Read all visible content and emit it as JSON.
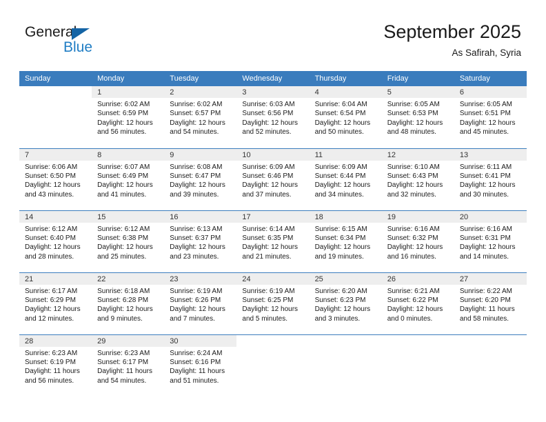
{
  "brand": {
    "name_top": "General",
    "name_bottom": "Blue",
    "triangle_icon": "blue-triangle-logo-mark",
    "colors": {
      "general_text": "#1a1a1a",
      "blue_text": "#1f7dc4",
      "triangle": "#1464a5"
    }
  },
  "header": {
    "title": "September 2025",
    "location": "As Safirah, Syria"
  },
  "theme": {
    "header_row_bg": "#3a7cbd",
    "header_row_text": "#ffffff",
    "daynum_band_bg": "#eeeeee",
    "cell_text": "#1a1a1a",
    "row_divider": "#3a7cbd"
  },
  "calendar": {
    "weekday_headers": [
      "Sunday",
      "Monday",
      "Tuesday",
      "Wednesday",
      "Thursday",
      "Friday",
      "Saturday"
    ],
    "weeks": [
      [
        {
          "blank": true
        },
        {
          "day": "1",
          "sunrise": "Sunrise: 6:02 AM",
          "sunset": "Sunset: 6:59 PM",
          "daylight": "Daylight: 12 hours and 56 minutes."
        },
        {
          "day": "2",
          "sunrise": "Sunrise: 6:02 AM",
          "sunset": "Sunset: 6:57 PM",
          "daylight": "Daylight: 12 hours and 54 minutes."
        },
        {
          "day": "3",
          "sunrise": "Sunrise: 6:03 AM",
          "sunset": "Sunset: 6:56 PM",
          "daylight": "Daylight: 12 hours and 52 minutes."
        },
        {
          "day": "4",
          "sunrise": "Sunrise: 6:04 AM",
          "sunset": "Sunset: 6:54 PM",
          "daylight": "Daylight: 12 hours and 50 minutes."
        },
        {
          "day": "5",
          "sunrise": "Sunrise: 6:05 AM",
          "sunset": "Sunset: 6:53 PM",
          "daylight": "Daylight: 12 hours and 48 minutes."
        },
        {
          "day": "6",
          "sunrise": "Sunrise: 6:05 AM",
          "sunset": "Sunset: 6:51 PM",
          "daylight": "Daylight: 12 hours and 45 minutes."
        }
      ],
      [
        {
          "day": "7",
          "sunrise": "Sunrise: 6:06 AM",
          "sunset": "Sunset: 6:50 PM",
          "daylight": "Daylight: 12 hours and 43 minutes."
        },
        {
          "day": "8",
          "sunrise": "Sunrise: 6:07 AM",
          "sunset": "Sunset: 6:49 PM",
          "daylight": "Daylight: 12 hours and 41 minutes."
        },
        {
          "day": "9",
          "sunrise": "Sunrise: 6:08 AM",
          "sunset": "Sunset: 6:47 PM",
          "daylight": "Daylight: 12 hours and 39 minutes."
        },
        {
          "day": "10",
          "sunrise": "Sunrise: 6:09 AM",
          "sunset": "Sunset: 6:46 PM",
          "daylight": "Daylight: 12 hours and 37 minutes."
        },
        {
          "day": "11",
          "sunrise": "Sunrise: 6:09 AM",
          "sunset": "Sunset: 6:44 PM",
          "daylight": "Daylight: 12 hours and 34 minutes."
        },
        {
          "day": "12",
          "sunrise": "Sunrise: 6:10 AM",
          "sunset": "Sunset: 6:43 PM",
          "daylight": "Daylight: 12 hours and 32 minutes."
        },
        {
          "day": "13",
          "sunrise": "Sunrise: 6:11 AM",
          "sunset": "Sunset: 6:41 PM",
          "daylight": "Daylight: 12 hours and 30 minutes."
        }
      ],
      [
        {
          "day": "14",
          "sunrise": "Sunrise: 6:12 AM",
          "sunset": "Sunset: 6:40 PM",
          "daylight": "Daylight: 12 hours and 28 minutes."
        },
        {
          "day": "15",
          "sunrise": "Sunrise: 6:12 AM",
          "sunset": "Sunset: 6:38 PM",
          "daylight": "Daylight: 12 hours and 25 minutes."
        },
        {
          "day": "16",
          "sunrise": "Sunrise: 6:13 AM",
          "sunset": "Sunset: 6:37 PM",
          "daylight": "Daylight: 12 hours and 23 minutes."
        },
        {
          "day": "17",
          "sunrise": "Sunrise: 6:14 AM",
          "sunset": "Sunset: 6:35 PM",
          "daylight": "Daylight: 12 hours and 21 minutes."
        },
        {
          "day": "18",
          "sunrise": "Sunrise: 6:15 AM",
          "sunset": "Sunset: 6:34 PM",
          "daylight": "Daylight: 12 hours and 19 minutes."
        },
        {
          "day": "19",
          "sunrise": "Sunrise: 6:16 AM",
          "sunset": "Sunset: 6:32 PM",
          "daylight": "Daylight: 12 hours and 16 minutes."
        },
        {
          "day": "20",
          "sunrise": "Sunrise: 6:16 AM",
          "sunset": "Sunset: 6:31 PM",
          "daylight": "Daylight: 12 hours and 14 minutes."
        }
      ],
      [
        {
          "day": "21",
          "sunrise": "Sunrise: 6:17 AM",
          "sunset": "Sunset: 6:29 PM",
          "daylight": "Daylight: 12 hours and 12 minutes."
        },
        {
          "day": "22",
          "sunrise": "Sunrise: 6:18 AM",
          "sunset": "Sunset: 6:28 PM",
          "daylight": "Daylight: 12 hours and 9 minutes."
        },
        {
          "day": "23",
          "sunrise": "Sunrise: 6:19 AM",
          "sunset": "Sunset: 6:26 PM",
          "daylight": "Daylight: 12 hours and 7 minutes."
        },
        {
          "day": "24",
          "sunrise": "Sunrise: 6:19 AM",
          "sunset": "Sunset: 6:25 PM",
          "daylight": "Daylight: 12 hours and 5 minutes."
        },
        {
          "day": "25",
          "sunrise": "Sunrise: 6:20 AM",
          "sunset": "Sunset: 6:23 PM",
          "daylight": "Daylight: 12 hours and 3 minutes."
        },
        {
          "day": "26",
          "sunrise": "Sunrise: 6:21 AM",
          "sunset": "Sunset: 6:22 PM",
          "daylight": "Daylight: 12 hours and 0 minutes."
        },
        {
          "day": "27",
          "sunrise": "Sunrise: 6:22 AM",
          "sunset": "Sunset: 6:20 PM",
          "daylight": "Daylight: 11 hours and 58 minutes."
        }
      ],
      [
        {
          "day": "28",
          "sunrise": "Sunrise: 6:23 AM",
          "sunset": "Sunset: 6:19 PM",
          "daylight": "Daylight: 11 hours and 56 minutes."
        },
        {
          "day": "29",
          "sunrise": "Sunrise: 6:23 AM",
          "sunset": "Sunset: 6:17 PM",
          "daylight": "Daylight: 11 hours and 54 minutes."
        },
        {
          "day": "30",
          "sunrise": "Sunrise: 6:24 AM",
          "sunset": "Sunset: 6:16 PM",
          "daylight": "Daylight: 11 hours and 51 minutes."
        },
        {
          "blank": true
        },
        {
          "blank": true
        },
        {
          "blank": true
        },
        {
          "blank": true
        }
      ]
    ]
  }
}
